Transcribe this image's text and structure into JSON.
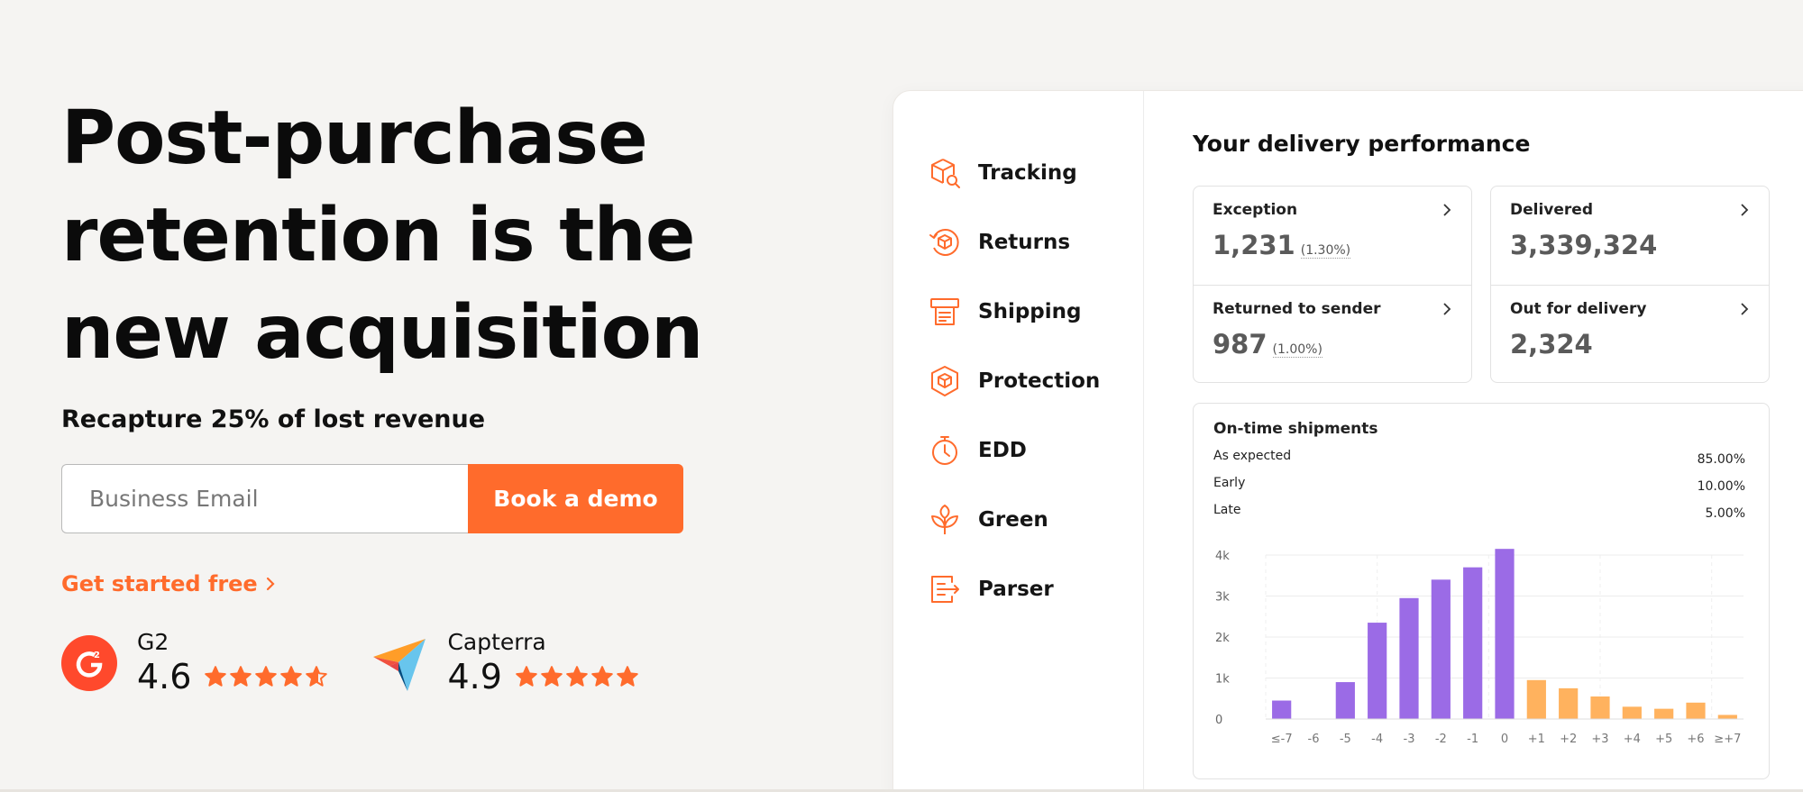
{
  "hero": {
    "headline": [
      "Post-purchase",
      "retention is the",
      "new acquisition"
    ],
    "subheadline": "Recapture 25% of lost revenue",
    "email_placeholder": "Business Email",
    "demo_button": "Book a demo",
    "get_started": "Get started free",
    "ratings": [
      {
        "brand": "G2",
        "score": "4.6",
        "stars": 4.6,
        "icon": "g2-logo"
      },
      {
        "brand": "Capterra",
        "score": "4.9",
        "stars": 4.9,
        "icon": "capterra-logo"
      }
    ]
  },
  "colors": {
    "accent": "#ff6b2c",
    "purple": "#9b6be6",
    "orange_bar": "#ffb25e"
  },
  "sidebar": {
    "items": [
      {
        "label": "Tracking",
        "icon": "box-search-icon"
      },
      {
        "label": "Returns",
        "icon": "return-box-icon"
      },
      {
        "label": "Shipping",
        "icon": "printer-icon"
      },
      {
        "label": "Protection",
        "icon": "shield-box-icon"
      },
      {
        "label": "EDD",
        "icon": "stopwatch-icon"
      },
      {
        "label": "Green",
        "icon": "leaf-icon"
      },
      {
        "label": "Parser",
        "icon": "document-arrow-icon"
      }
    ]
  },
  "main": {
    "title": "Your delivery performance",
    "stats": [
      {
        "label": "Exception",
        "value": "1,231",
        "pct": "(1.30%)"
      },
      {
        "label": "Returned to sender",
        "value": "987",
        "pct": "(1.00%)"
      },
      {
        "label": "Delivered",
        "value": "3,339,324",
        "pct": ""
      },
      {
        "label": "Out for delivery",
        "value": "2,324",
        "pct": ""
      }
    ],
    "chart_title": "On-time shipments",
    "legend": [
      {
        "label": "As expected",
        "pct": "85.00%"
      },
      {
        "label": "Early",
        "pct": "10.00%"
      },
      {
        "label": "Late",
        "pct": "5.00%"
      }
    ]
  },
  "chart_data": {
    "type": "bar",
    "title": "On-time shipments",
    "categories": [
      "≤-7",
      "-6",
      "-5",
      "-4",
      "-3",
      "-2",
      "-1",
      "0",
      "+1",
      "+2",
      "+3",
      "+4",
      "+5",
      "+6",
      "≥+7"
    ],
    "values": [
      450,
      0,
      900,
      2350,
      2950,
      3400,
      3700,
      4150,
      950,
      750,
      550,
      300,
      250,
      400,
      100
    ],
    "bar_groups": [
      "early",
      "early",
      "early",
      "early",
      "early",
      "early",
      "early",
      "early",
      "late",
      "late",
      "late",
      "late",
      "late",
      "late",
      "late"
    ],
    "yticks": [
      "0",
      "1k",
      "2k",
      "3k",
      "4k"
    ],
    "ylim": [
      0,
      4000
    ],
    "grid": true
  }
}
